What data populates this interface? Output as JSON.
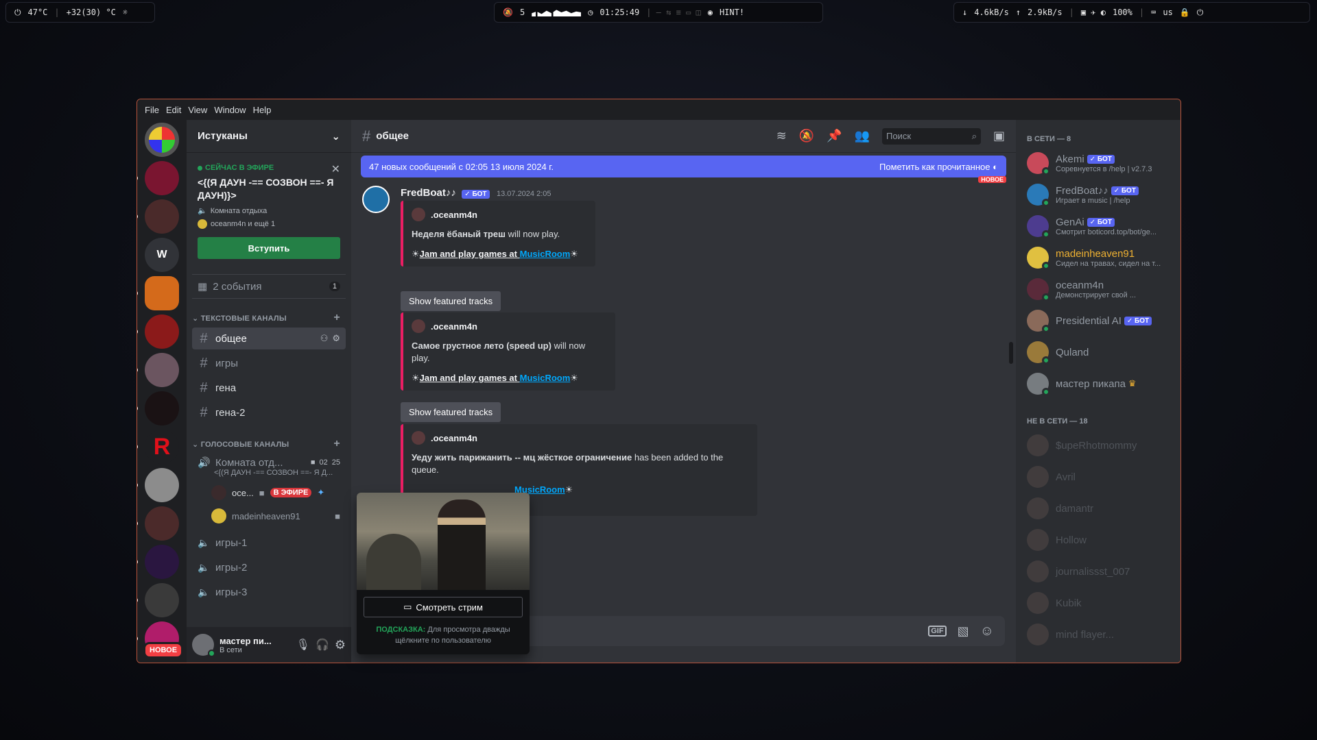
{
  "statusbar": {
    "left": {
      "cpu_temp": "47°C",
      "weather": "+32(30) °C"
    },
    "center": {
      "workspace": "5",
      "clock": "01:25:49",
      "hint": "HINT!"
    },
    "right": {
      "down": "4.6kB/s",
      "up": "2.9kB/s",
      "volume": "100%",
      "layout": "us"
    }
  },
  "menubar": [
    "File",
    "Edit",
    "View",
    "Window",
    "Help"
  ],
  "servers": [
    {
      "letter": ""
    },
    {
      "letter": ""
    },
    {
      "letter": ""
    },
    {
      "letter": "W"
    },
    {
      "letter": ""
    },
    {
      "letter": ""
    },
    {
      "letter": ""
    },
    {
      "letter": ""
    },
    {
      "letter": "R"
    },
    {
      "letter": ""
    },
    {
      "letter": ""
    },
    {
      "letter": ""
    },
    {
      "letter": ""
    },
    {
      "letter": ""
    }
  ],
  "servers_new_badge": "НОВОЕ",
  "guild": {
    "name": "Истуканы",
    "live": {
      "tag": "СЕЙЧАС В ЭФИРЕ",
      "title": "<{(Я ДАУН -== СОЗВОН ==- Я ДАУН)}>",
      "room": "Комната отдыха",
      "people": "oceanm4n и ещё 1",
      "join": "Вступить"
    },
    "events": {
      "label": "2 события",
      "count": "1"
    },
    "text_category": "ТЕКСТОВЫЕ КАНАЛЫ",
    "text_channels": [
      "общее",
      "игры",
      "гена",
      "гена-2"
    ],
    "voice_category": "ГОЛОСОВЫЕ КАНАЛЫ",
    "voice_room": {
      "name": "Комната отд...",
      "sub": "<{(Я ДАУН -== СОЗВОН ==- Я Д...",
      "count_a": "02",
      "count_b": "25"
    },
    "voice_users": [
      {
        "name": "осе...",
        "badge": "В ЭФИРЕ"
      },
      {
        "name": "madeinheaven91",
        "badge": ""
      }
    ],
    "voice_channels": [
      "игры-1",
      "игры-2",
      "игры-3"
    ],
    "user": {
      "name": "мастер пи...",
      "status": "В сети"
    }
  },
  "chat": {
    "channel": "общее",
    "search_placeholder": "Поиск",
    "banner": {
      "text": "47 новых сообщений с 02:05 13 июля 2024 г.",
      "action": "Пометить как прочитанное"
    },
    "new_divider": "НОВОЕ",
    "message": {
      "author": "FredBoat♪♪",
      "bot_tag": "✓ БОТ",
      "time": "13.07.2024 2:05"
    },
    "embeds": [
      {
        "author": ".oceanm4n",
        "track": "Неделя ёбаный треш",
        "suffix": " will now play.",
        "link_a": "Jam and play games at ",
        "link_b": "MusicRoom",
        "button": "Show featured tracks"
      },
      {
        "author": ".oceanm4n",
        "track": "Самое грустное лето (speed up)",
        "suffix": " will now play.",
        "link_a": "Jam and play games at ",
        "link_b": "MusicRoom",
        "button": "Show featured tracks"
      },
      {
        "author": ".oceanm4n",
        "track": "Уеду жить парижанить -- мц жёсткое ограничение",
        "suffix": " has been added to the queue.",
        "link_a": "",
        "link_b": "MusicRoom",
        "button": ""
      }
    ],
    "composer_icons": [
      "GIF",
      "sticker",
      "emoji"
    ]
  },
  "popup": {
    "watch": "Смотреть стрим",
    "hint_label": "ПОДСКАЗКА:",
    "hint_text": " Для просмотра дважды щёлкните по пользователю"
  },
  "members": {
    "online_header": "В СЕТИ — 8",
    "online": [
      {
        "name": "Akemi",
        "bot": "✓ БОТ",
        "status": "Соревнуется в /help | v2.7.3",
        "color": "#949ba4"
      },
      {
        "name": "FredBoat♪♪",
        "bot": "✓ БОТ",
        "status": "Играет в music | /help",
        "color": "#949ba4"
      },
      {
        "name": "GenAi",
        "bot": "✓ БОТ",
        "status": "Смотрит boticord.top/bot/ge...",
        "color": "#949ba4"
      },
      {
        "name": "madeinheaven91",
        "bot": "",
        "status": "Сидел на травах, сидел на т...",
        "color": "#f0b232"
      },
      {
        "name": "oceanm4n",
        "bot": "",
        "status": "Демонстрирует свой ...",
        "color": "#949ba4"
      },
      {
        "name": "Presidential AI",
        "bot": "✓ БОТ",
        "status": "",
        "color": "#949ba4"
      },
      {
        "name": "Quland",
        "bot": "",
        "status": "",
        "color": "#949ba4"
      },
      {
        "name": "мастер пикапа",
        "bot": "",
        "status": "",
        "color": "#949ba4",
        "crown": "♛"
      }
    ],
    "offline_header": "НЕ В СЕТИ — 18",
    "offline": [
      "$upeRhotmommy",
      "Avril",
      "damantr",
      "Hollow",
      "journalissst_007",
      "Kubik",
      "mind flayer..."
    ]
  }
}
